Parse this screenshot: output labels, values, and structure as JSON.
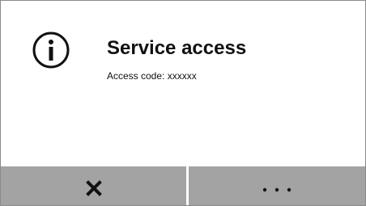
{
  "dialog": {
    "icon": "info-icon",
    "title": "Service access",
    "message": "Access code: xxxxxx"
  },
  "buttons": {
    "close": {
      "icon": "close-icon"
    },
    "more": {
      "icon": "more-icon"
    }
  },
  "colors": {
    "background": "#ffffff",
    "text": "#111111",
    "button_bar": "#a3a3a3",
    "border": "#8a8a8a"
  }
}
